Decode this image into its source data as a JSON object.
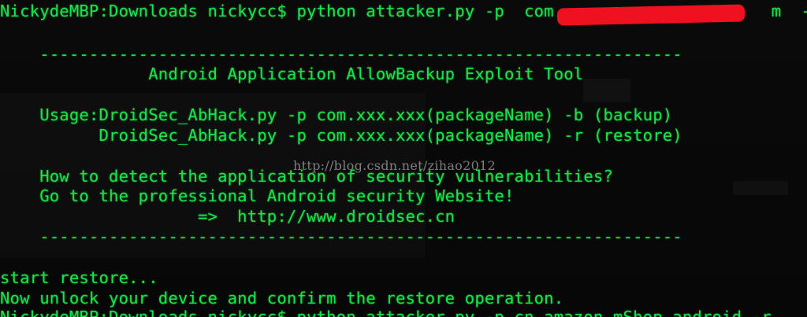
{
  "terminal": {
    "lines": {
      "cmd1": "NickydeMBP:Downloads nickycc$ python attacker.py -p  com.          .          m  -r",
      "rule_top": "    -----------------------------------------------------------------",
      "title": "               Android Application AllowBackup Exploit Tool",
      "usage1": "    Usage:DroidSec_AbHack.py -p com.xxx.xxx(packageName) -b (backup)",
      "usage2": "          DroidSec_AbHack.py -p com.xxx.xxx(packageName) -r (restore)",
      "detect": "    How to detect the application of security vulnerabilities?",
      "goto": "    Go to the professional Android security Website!",
      "url": "                    =>  http://www.droidsec.cn",
      "rule_bottom": "    -----------------------------------------------------------------",
      "start_restore": "start restore...",
      "unlock": "Now unlock your device and confirm the restore operation.",
      "cmd2": "NickydeMBP:Downloads nickycc$ python attacker.py -p cn.amazon.mShop.android -r"
    },
    "watermark": "http://blog.csdn.net/zihao2012",
    "colors": {
      "text": "#19e34a",
      "background": "#050505",
      "redaction": "#ef1020"
    }
  }
}
